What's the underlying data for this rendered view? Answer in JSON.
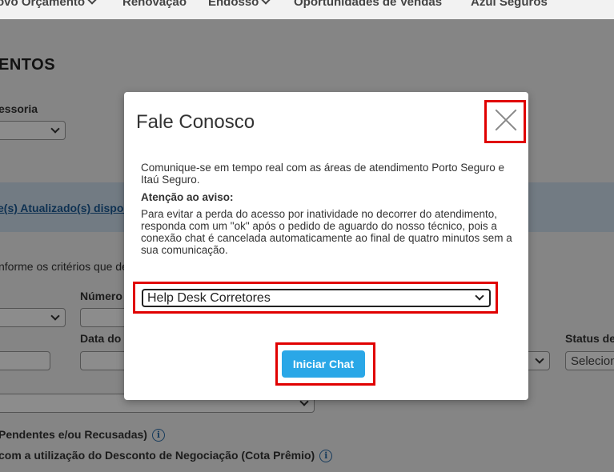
{
  "nav": {
    "items": [
      "ovo Orçamento",
      "Renovação",
      "Endosso",
      "Oportunidades de Vendas",
      "Azul Seguros"
    ]
  },
  "background": {
    "title": "ENTOS",
    "assessoria_label": "essoria",
    "update_link": "e(s) Atualizado(s)",
    "update_rest": " dispor",
    "criteria_text": "nforme os critérios que de",
    "numero_label": "Número",
    "data_label": "Data do",
    "status_label": "Status de",
    "status_value": "Selecion",
    "pendentes_text": "Pendentes e/ou Recusadas)",
    "desconto_text": "com a utilização do Desconto de Negociação (Cota Prêmio)"
  },
  "modal": {
    "title": "Fale Conosco",
    "intro": "Comunique-se em tempo real com as áreas de atendimento Porto Seguro e Itaú Seguro.",
    "warning_title": "Atenção ao aviso:",
    "warning_text": "Para evitar a perda do acesso por inatividade no decorrer do atendimento, responda com um \"ok\" após o pedido de aguardo do nosso técnico, pois a conexão chat é cancelada automaticamente ao final de quatro minutos sem a sua comunicação.",
    "select_value": "Help Desk Corretores",
    "button_label": "Iniciar Chat"
  },
  "icons": {
    "close": "close-icon",
    "info": "info-icon",
    "chevron": "chevron-down-icon"
  },
  "colors": {
    "highlight": "#e00000",
    "button": "#2aa7e7",
    "link": "#1a5a96"
  }
}
